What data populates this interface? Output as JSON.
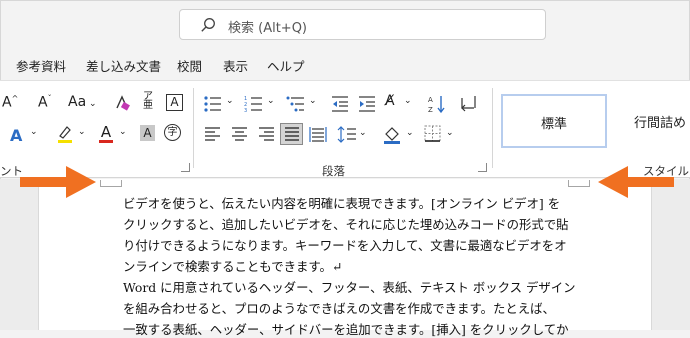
{
  "search": {
    "placeholder": "検索 (Alt+Q)"
  },
  "menu_tabs": [
    "参考資料",
    "差し込み文書",
    "校閲",
    "表示",
    "ヘルプ"
  ],
  "ribbon": {
    "font_group_label": "ント",
    "paragraph_group_label": "段落",
    "styles_group_label": "スタイル",
    "font_size_label": "Aa",
    "styles": [
      "標準",
      "行間詰め"
    ]
  },
  "document": {
    "lines": [
      "ビデオを使うと、伝えたい内容を明確に表現できます。[オンライン ビデオ] を",
      "クリックすると、追加したいビデオを、それに応じた埋め込みコードの形式で貼",
      "り付けできるようになります。キーワードを入力して、文書に最適なビデオをオ",
      "ンラインで検索することもできます。↵",
      "Word に用意されているヘッダー、フッター、表紙、テキスト ボックス デザイン",
      "を組み合わせると、プロのようなできばえの文書を作成できます。たとえば、",
      "一致する表紙、ヘッダー、サイドバーを追加できます。[挿入] をクリックしてか"
    ]
  },
  "colors": {
    "arrow": "#f07021",
    "style_border": "#b7cdee",
    "font_color": "#d9281e",
    "highlight": "#f5e000"
  }
}
